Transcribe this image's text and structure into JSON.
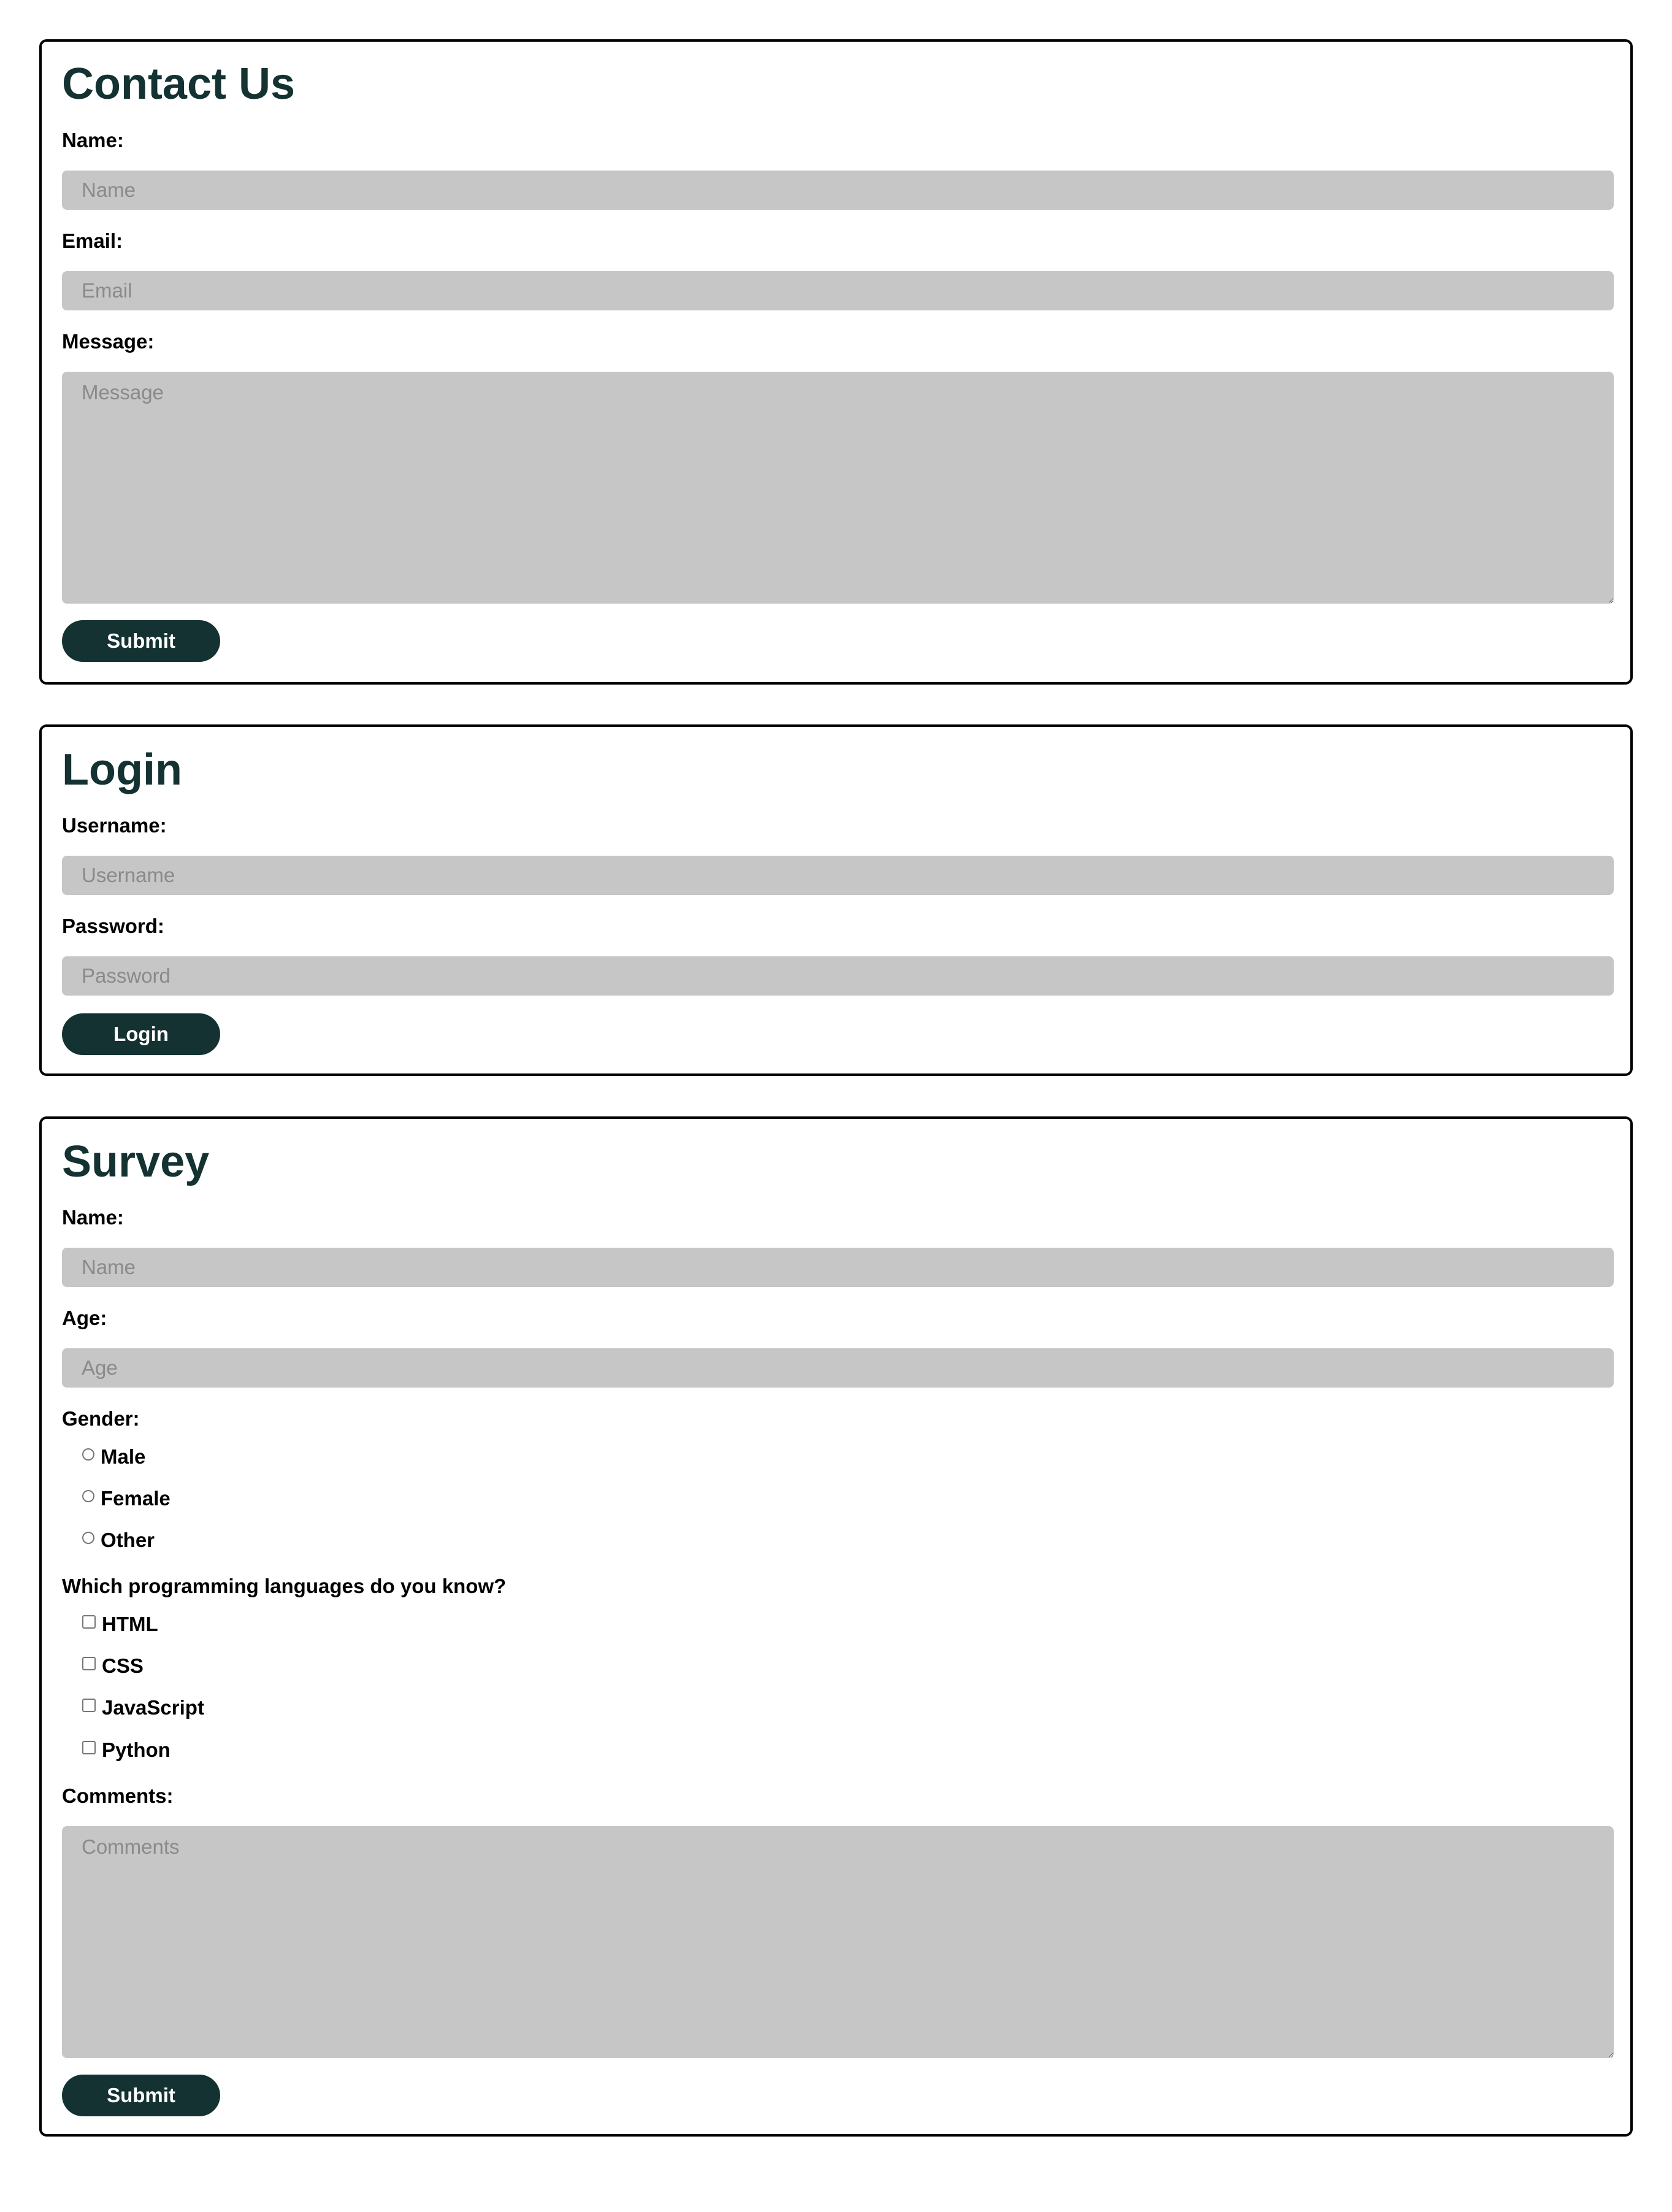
{
  "contact": {
    "title": "Contact Us",
    "name_label": "Name:",
    "name_placeholder": "Name",
    "email_label": "Email:",
    "email_placeholder": "Email",
    "message_label": "Message:",
    "message_placeholder": "Message",
    "submit_label": "Submit"
  },
  "login": {
    "title": "Login",
    "username_label": "Username:",
    "username_placeholder": "Username",
    "password_label": "Password:",
    "password_placeholder": "Password",
    "login_label": "Login"
  },
  "survey": {
    "title": "Survey",
    "name_label": "Name:",
    "name_placeholder": "Name",
    "age_label": "Age:",
    "age_placeholder": "Age",
    "gender_label": "Gender:",
    "gender_options": [
      "Male",
      "Female",
      "Other"
    ],
    "languages_label": "Which programming languages do you know?",
    "language_options": [
      "HTML",
      "CSS",
      "JavaScript",
      "Python"
    ],
    "comments_label": "Comments:",
    "comments_placeholder": "Comments",
    "submit_label": "Submit"
  },
  "colors": {
    "accent": "#143232",
    "input_background": "#c6c6c6",
    "border": "#000000"
  }
}
